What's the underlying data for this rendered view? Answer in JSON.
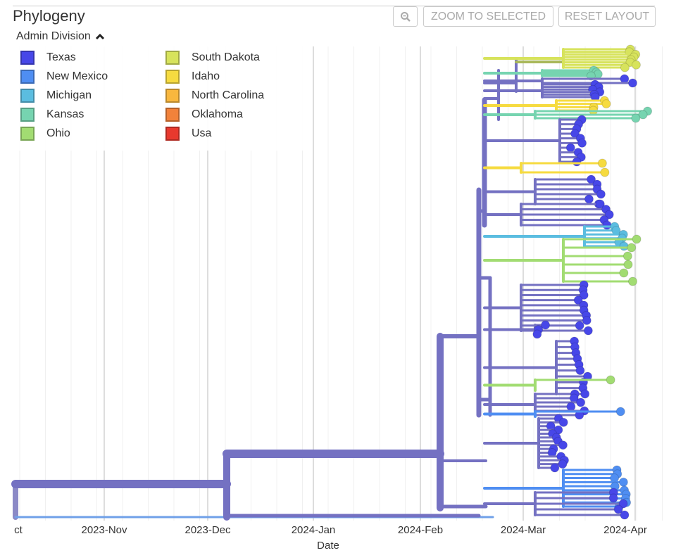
{
  "panel": {
    "title": "Phylogeny"
  },
  "toolbar": {
    "zoom_icon": "magnifier-minus-icon",
    "zoom_to_selected": "ZOOM TO SELECTED",
    "reset_layout": "RESET LAYOUT"
  },
  "legend": {
    "title": "Admin Division",
    "toggle_icon": "chevron-up-icon",
    "items": [
      {
        "label": "Texas",
        "color": "#4747e8"
      },
      {
        "label": "New Mexico",
        "color": "#4f8ef2"
      },
      {
        "label": "Michigan",
        "color": "#5bbde0"
      },
      {
        "label": "Kansas",
        "color": "#76d4b0"
      },
      {
        "label": "Ohio",
        "color": "#a2dc72"
      },
      {
        "label": "South Dakota",
        "color": "#d7e35c"
      },
      {
        "label": "Idaho",
        "color": "#f6db40"
      },
      {
        "label": "North Carolina",
        "color": "#f8b73e"
      },
      {
        "label": "Oklahoma",
        "color": "#f2823a"
      },
      {
        "label": "Usa",
        "color": "#e8392e"
      }
    ]
  },
  "axis": {
    "ticks": [
      "ct",
      "2023-Nov",
      "2023-Dec",
      "2024-Jan",
      "2024-Feb",
      "2024-Mar",
      "2024-Apr"
    ],
    "label": "Date"
  },
  "colors": {
    "branch": "#7471c2"
  }
}
